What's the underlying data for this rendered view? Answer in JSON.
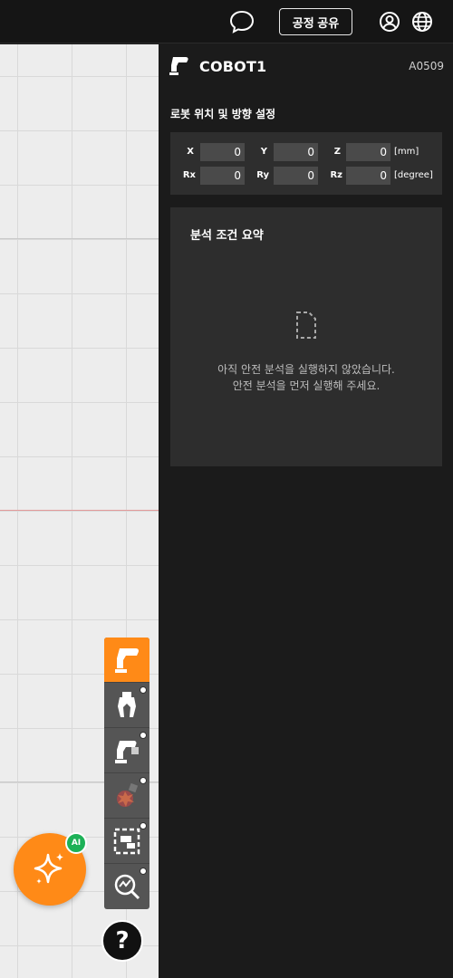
{
  "topbar": {
    "share_label": "공정 공유",
    "icons": [
      "chat-icon",
      "user-icon",
      "globe-icon"
    ]
  },
  "robot": {
    "name": "COBOT1",
    "code": "A0509"
  },
  "position": {
    "section_title": "로봇 위치 및 방향 설정",
    "row1": {
      "x_label": "X",
      "x_value": "0",
      "y_label": "Y",
      "y_value": "0",
      "z_label": "Z",
      "z_value": "0",
      "unit": "[mm]"
    },
    "row2": {
      "rx_label": "Rx",
      "rx_value": "0",
      "ry_label": "Ry",
      "ry_value": "0",
      "rz_label": "Rz",
      "rz_value": "0",
      "unit": "[degree]"
    }
  },
  "summary": {
    "title": "분석 조건 요약",
    "message_line1": "아직 안전 분석을 실행하지 않았습니다.",
    "message_line2": "안전 분석을 먼저 실행해 주세요."
  },
  "dock": {
    "items": [
      "robot-arm-icon",
      "gripper-icon",
      "robot-tool-icon",
      "collision-icon",
      "zone-icon",
      "analysis-icon"
    ]
  },
  "ai": {
    "badge": "AI"
  },
  "help": {
    "label": "?"
  },
  "colors": {
    "accent": "#ff8a17",
    "ai_badge": "#1db157",
    "panel_bg": "#1b1b1b",
    "box_bg": "#2e2e2e"
  }
}
